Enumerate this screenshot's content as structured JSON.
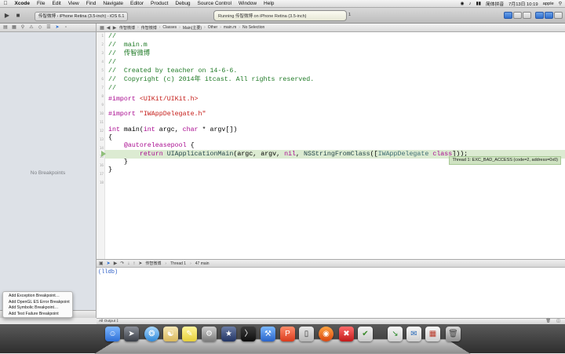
{
  "menubar": {
    "items": [
      "Xcode",
      "File",
      "Edit",
      "View",
      "Find",
      "Navigate",
      "Editor",
      "Product",
      "Debug",
      "Source Control",
      "Window",
      "Help"
    ],
    "input_method": "简体拼音",
    "clock": "7月13日 10:19",
    "user": "apple"
  },
  "toolbar": {
    "scheme": "传智微博 › iPhone Retina (3.5-inch) - iOS 6.1",
    "activity": "Running 传智微博 on iPhone Retina (3.5-inch)",
    "activity_counter": "1"
  },
  "sidebar": {
    "empty_label": "No Breakpoints"
  },
  "breakpoint_menu": {
    "items": [
      "Add Exception Breakpoint…",
      "Add OpenGL ES Error Breakpoint",
      "Add Symbolic Breakpoint…",
      "Add Test Failure Breakpoint"
    ]
  },
  "jumpbar": {
    "crumbs": [
      "传智微博",
      "传智微博",
      "Classes",
      "Main(主要)",
      "Other",
      "main.m",
      "No Selection"
    ]
  },
  "editor": {
    "line_numbers": [
      "1",
      "2",
      "3",
      "4",
      "5",
      "6",
      "7",
      "8",
      "9",
      "10",
      "11",
      "12",
      "13",
      "14",
      "15",
      "16",
      "17",
      "18"
    ],
    "code": {
      "l1": "//",
      "l2": "//  main.m",
      "l3": "//  传智微博",
      "l4": "//",
      "l5": "//  Created by teacher on 14-6-6.",
      "l6": "//  Copyright (c) 2014年 itcast. All rights reserved.",
      "l7": "//",
      "l9_kw": "#import ",
      "l9_str": "<UIKit/UIKit.h>",
      "l11_kw": "#import ",
      "l11_str": "\"IWAppDelegate.h\"",
      "l13_kw1": "int",
      "l13_mid": " main(",
      "l13_kw2": "int",
      "l13_mid2": " argc, ",
      "l13_kw3": "char",
      "l13_end": " * argv[])",
      "l14": "{",
      "l15_kw": "@autoreleasepool",
      "l15_end": " {",
      "l16_kw": "return",
      "l16_fn": "UIApplicationMain",
      "l16_args": "(argc, argv, ",
      "l16_nil": "nil",
      "l16_comma": ", ",
      "l16_fn2": "NSStringFromClass",
      "l16_open": "([",
      "l16_cls": "IWAppDelegate",
      "l16_sp": " ",
      "l16_kw2": "class",
      "l16_close": "]));",
      "l17": "    }",
      "l18": "}"
    },
    "exception": "Thread 1: EXC_BAD_ACCESS (code=2, address=0x0)"
  },
  "debugbar": {
    "crumbs": [
      "传智微博",
      "Thread 1",
      "47 main"
    ]
  },
  "console": {
    "prompt": "(lldb)",
    "output_selector": "All Output ‡"
  }
}
